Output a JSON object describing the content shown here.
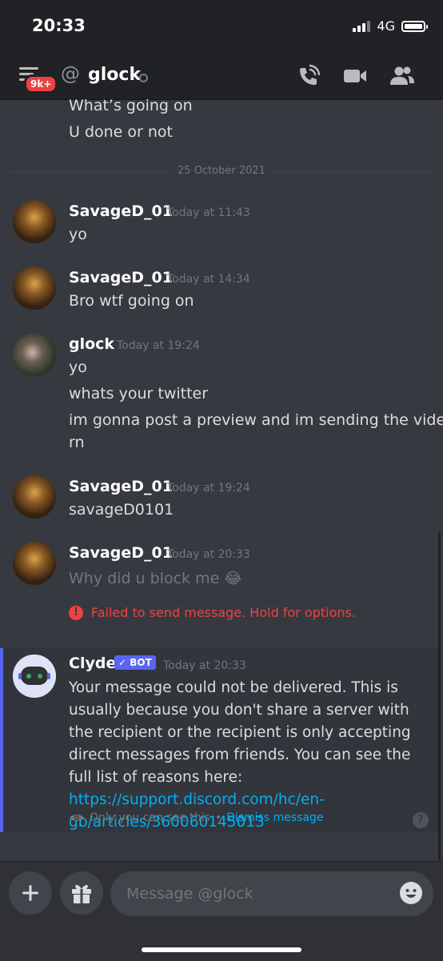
{
  "status_bar": {
    "time": "20:33",
    "network": "4G"
  },
  "header": {
    "badge": "9k+",
    "at": "@",
    "channel_name": "glock"
  },
  "messages": {
    "previous": [
      "What’s going on",
      "U done or not"
    ],
    "date_divider": "25 October 2021",
    "group1": {
      "author": "SavageD_01",
      "time": "Today at 11:43",
      "lines": [
        "yo"
      ]
    },
    "group2": {
      "author": "SavageD_01",
      "time": "Today at 14:34",
      "lines": [
        "Bro wtf going on"
      ]
    },
    "group3": {
      "author": "glock",
      "time": "Today at 19:24",
      "lines": [
        "yo",
        "whats your twitter",
        "im gonna post a preview and im sending the video",
        "rn"
      ]
    },
    "group4": {
      "author": "SavageD_01",
      "time": "Today at 19:24",
      "lines": [
        "savageD0101"
      ]
    },
    "group5": {
      "author": "SavageD_01",
      "time": "Today at 20:33",
      "lines": [
        "Why did u block me 😂"
      ],
      "error": "Failed to send message. Hold for options."
    }
  },
  "clyde": {
    "author": "Clyde",
    "bot_tag": "BOT",
    "time": "Today at 20:33",
    "text": "Your message could not be delivered. This is usually because you don't share a server with the recipient or the recipient is only accepting direct messages from friends. You can see the full list of reasons here: ",
    "link": "https://support.discord.com/hc/en-gb/articles/360060145013",
    "only_you": "Only you can see this",
    "separator": "•",
    "dismiss": "Dismiss message",
    "help": "?"
  },
  "composer": {
    "placeholder": "Message @glock",
    "add_icon": "plus-icon",
    "gift_icon": "gift-icon",
    "emoji_icon": "emoji-icon"
  },
  "colors": {
    "accent": "#5865f2",
    "error": "#ed4245",
    "link": "#00aff4",
    "background": "#36393f"
  }
}
